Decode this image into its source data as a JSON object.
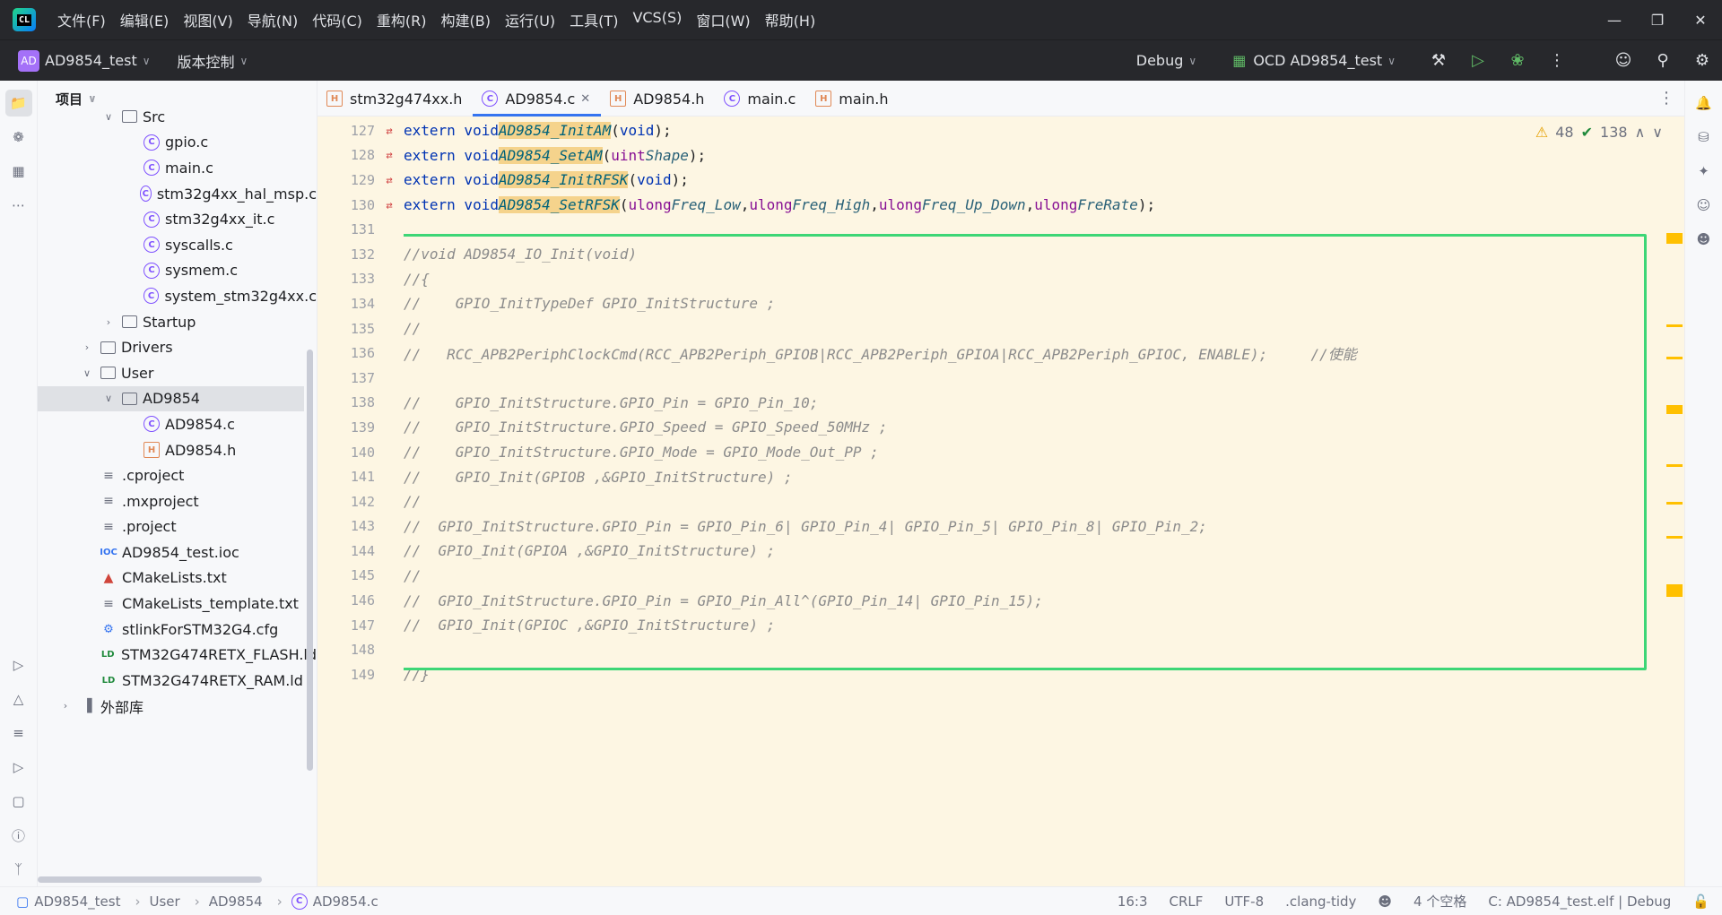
{
  "menu": {
    "items": [
      "文件(F)",
      "编辑(E)",
      "视图(V)",
      "导航(N)",
      "代码(C)",
      "重构(R)",
      "构建(B)",
      "运行(U)",
      "工具(T)",
      "VCS(S)",
      "窗口(W)",
      "帮助(H)"
    ],
    "logo_text": "CL"
  },
  "toolbar": {
    "project_badge": "AD",
    "project_name": "AD9854_test",
    "vcs_label": "版本控制",
    "build_config": "Debug",
    "run_config": "OCD AD9854_test"
  },
  "project_panel": {
    "title": "项目",
    "rows": [
      {
        "label": "Src",
        "indent": 2,
        "arrow": "open",
        "icon": "folder"
      },
      {
        "label": "gpio.c",
        "indent": 3,
        "arrow": "",
        "icon": "c"
      },
      {
        "label": "main.c",
        "indent": 3,
        "arrow": "",
        "icon": "c"
      },
      {
        "label": "stm32g4xx_hal_msp.c",
        "indent": 3,
        "arrow": "",
        "icon": "c"
      },
      {
        "label": "stm32g4xx_it.c",
        "indent": 3,
        "arrow": "",
        "icon": "c"
      },
      {
        "label": "syscalls.c",
        "indent": 3,
        "arrow": "",
        "icon": "c"
      },
      {
        "label": "sysmem.c",
        "indent": 3,
        "arrow": "",
        "icon": "c"
      },
      {
        "label": "system_stm32g4xx.c",
        "indent": 3,
        "arrow": "",
        "icon": "c"
      },
      {
        "label": "Startup",
        "indent": 2,
        "arrow": "closed",
        "icon": "folder"
      },
      {
        "label": "Drivers",
        "indent": 1,
        "arrow": "closed",
        "icon": "folder"
      },
      {
        "label": "User",
        "indent": 1,
        "arrow": "open",
        "icon": "folder"
      },
      {
        "label": "AD9854",
        "indent": 2,
        "arrow": "open",
        "icon": "folder",
        "selected": true
      },
      {
        "label": "AD9854.c",
        "indent": 3,
        "arrow": "",
        "icon": "c"
      },
      {
        "label": "AD9854.h",
        "indent": 3,
        "arrow": "",
        "icon": "h"
      },
      {
        "label": ".cproject",
        "indent": 1,
        "arrow": "",
        "icon": "text"
      },
      {
        "label": ".mxproject",
        "indent": 1,
        "arrow": "",
        "icon": "text"
      },
      {
        "label": ".project",
        "indent": 1,
        "arrow": "",
        "icon": "text"
      },
      {
        "label": "AD9854_test.ioc",
        "indent": 1,
        "arrow": "",
        "icon": "ioc"
      },
      {
        "label": "CMakeLists.txt",
        "indent": 1,
        "arrow": "",
        "icon": "cmake"
      },
      {
        "label": "CMakeLists_template.txt",
        "indent": 1,
        "arrow": "",
        "icon": "text"
      },
      {
        "label": "stlinkForSTM32G4.cfg",
        "indent": 1,
        "arrow": "",
        "icon": "cfg"
      },
      {
        "label": "STM32G474RETX_FLASH.ld",
        "indent": 1,
        "arrow": "",
        "icon": "ld"
      },
      {
        "label": "STM32G474RETX_RAM.ld",
        "indent": 1,
        "arrow": "",
        "icon": "ld"
      },
      {
        "label": "外部库",
        "indent": 0,
        "arrow": "closed",
        "icon": "lib"
      }
    ]
  },
  "tabs": [
    {
      "label": "stm32g474xx.h",
      "icon": "h",
      "active": false
    },
    {
      "label": "AD9854.c",
      "icon": "c",
      "active": true
    },
    {
      "label": "AD9854.h",
      "icon": "h",
      "active": false
    },
    {
      "label": "main.c",
      "icon": "c",
      "active": false
    },
    {
      "label": "main.h",
      "icon": "h",
      "active": false
    }
  ],
  "inspections": {
    "warnings": "48",
    "ok": "138"
  },
  "code_lines": [
    {
      "n": "127",
      "mark": true,
      "html": "<span class='kw'>extern void</span> <span class='fn'>AD9854_InitAM</span>(<span class='kw'>void</span>);"
    },
    {
      "n": "128",
      "mark": true,
      "html": "<span class='kw'>extern void</span> <span class='fn'>AD9854_SetAM</span>(<span class='ty'>uint</span> <span class='param'>Shape</span>);"
    },
    {
      "n": "129",
      "mark": true,
      "html": "<span class='kw'>extern void</span> <span class='fn'>AD9854_InitRFSK</span>(<span class='kw'>void</span>);"
    },
    {
      "n": "130",
      "mark": true,
      "html": "<span class='kw'>extern void</span> <span class='fn'>AD9854_SetRFSK</span>(<span class='ty'>ulong</span> <span class='param'>Freq_Low</span>,<span class='ty'>ulong</span> <span class='param'>Freq_High</span>,<span class='ty'>ulong</span> <span class='param'>Freq_Up_Down</span>,<span class='ty'>ulong</span> <span class='param'>FreRate</span>);"
    },
    {
      "n": "131",
      "mark": false,
      "html": ""
    },
    {
      "n": "132",
      "mark": false,
      "html": "<span class='cm'>//void AD9854_IO_Init(void)</span>"
    },
    {
      "n": "133",
      "mark": false,
      "html": "<span class='cm'>//{</span>"
    },
    {
      "n": "134",
      "mark": false,
      "html": "<span class='cm'>//    GPIO_InitTypeDef GPIO_InitStructure ;</span>"
    },
    {
      "n": "135",
      "mark": false,
      "html": "<span class='cm'>//</span>"
    },
    {
      "n": "136",
      "mark": false,
      "html": "<span class='cm'>//   RCC_APB2PeriphClockCmd(RCC_APB2Periph_GPIOB|RCC_APB2Periph_GPIOA|RCC_APB2Periph_GPIOC, ENABLE);     //使能</span>"
    },
    {
      "n": "137",
      "mark": false,
      "html": ""
    },
    {
      "n": "138",
      "mark": false,
      "html": "<span class='cm'>//    GPIO_InitStructure.GPIO_Pin = GPIO_Pin_10;</span>"
    },
    {
      "n": "139",
      "mark": false,
      "html": "<span class='cm'>//    GPIO_InitStructure.GPIO_Speed = GPIO_Speed_50MHz ;</span>"
    },
    {
      "n": "140",
      "mark": false,
      "html": "<span class='cm'>//    GPIO_InitStructure.GPIO_Mode = GPIO_Mode_Out_PP ;</span>"
    },
    {
      "n": "141",
      "mark": false,
      "html": "<span class='cm'>//    GPIO_Init(GPIOB ,&amp;GPIO_InitStructure) ;</span>"
    },
    {
      "n": "142",
      "mark": false,
      "html": "<span class='cm'>//</span>"
    },
    {
      "n": "143",
      "mark": false,
      "html": "<span class='cm'>//  GPIO_InitStructure.GPIO_Pin = GPIO_Pin_6| GPIO_Pin_4| GPIO_Pin_5| GPIO_Pin_8| GPIO_Pin_2;</span>"
    },
    {
      "n": "144",
      "mark": false,
      "html": "<span class='cm'>//  GPIO_Init(GPIOA ,&amp;GPIO_InitStructure) ;</span>"
    },
    {
      "n": "145",
      "mark": false,
      "html": "<span class='cm'>//</span>"
    },
    {
      "n": "146",
      "mark": false,
      "html": "<span class='cm'>//  GPIO_InitStructure.GPIO_Pin = GPIO_Pin_All^(GPIO_Pin_14| GPIO_Pin_15);</span>"
    },
    {
      "n": "147",
      "mark": false,
      "html": "<span class='cm'>//  GPIO_Init(GPIOC ,&amp;GPIO_InitStructure) ;</span>"
    },
    {
      "n": "148",
      "mark": false,
      "html": ""
    },
    {
      "n": "149",
      "mark": false,
      "html": "<span class='cm'>//}</span>"
    }
  ],
  "statusbar": {
    "breadcrumbs": [
      "AD9854_test",
      "User",
      "AD9854",
      "AD9854.c"
    ],
    "position": "16:3",
    "line_ending": "CRLF",
    "encoding": "UTF-8",
    "linter": ".clang-tidy",
    "indent": "4 个空格",
    "context": "C: AD9854_test.elf | Debug"
  }
}
